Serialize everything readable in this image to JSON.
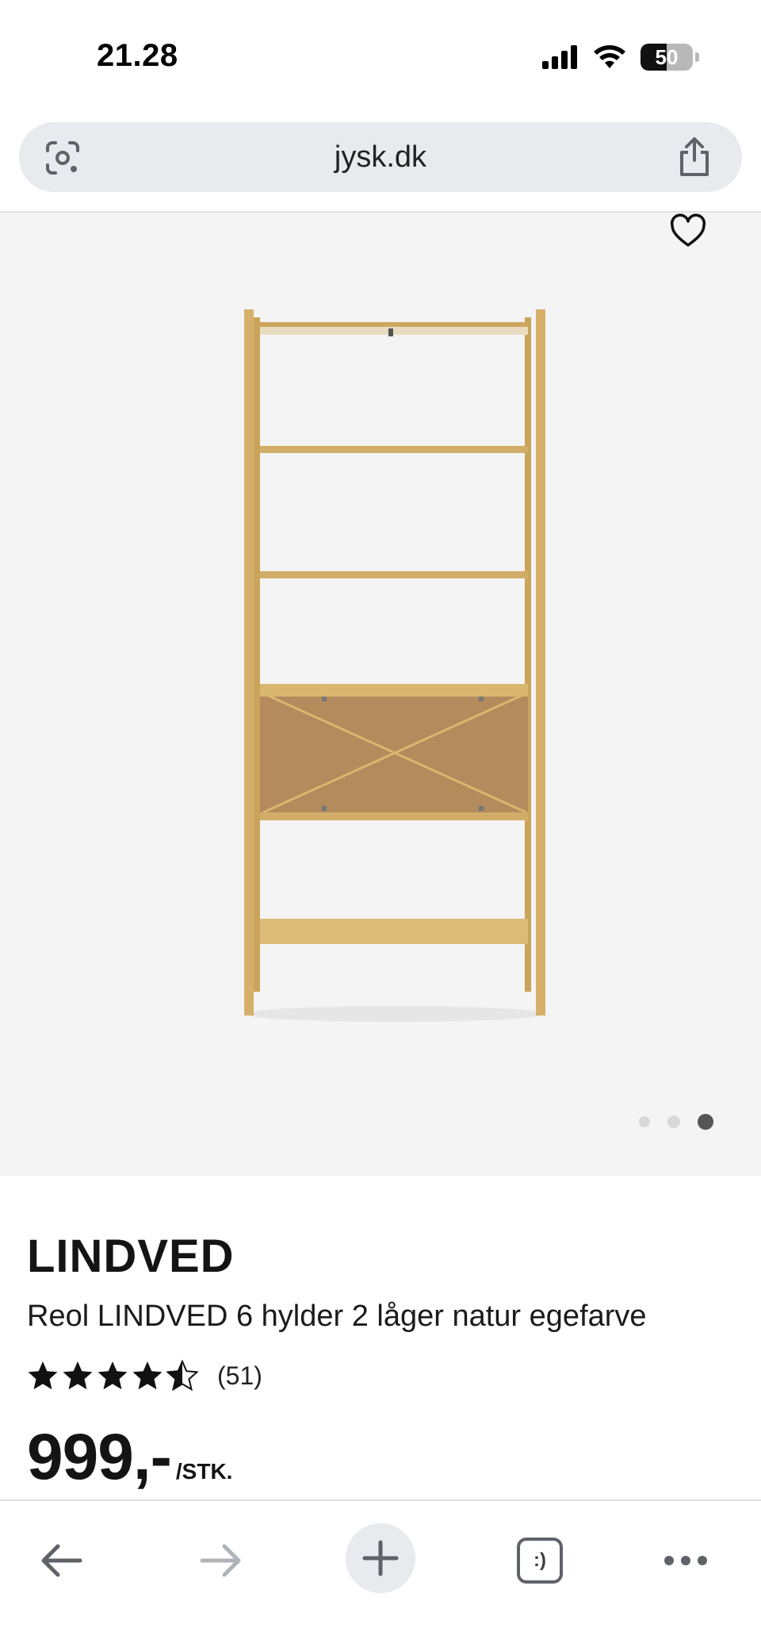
{
  "status_bar": {
    "time": "21.28",
    "battery": "50",
    "battery_level": 0.5
  },
  "browser": {
    "url": "jysk.dk",
    "icons": {
      "lens": "google-lens-icon",
      "share": "share-icon"
    }
  },
  "product": {
    "brand": "LINDVED",
    "title": "Reol LINDVED 6 hylder 2 låger natur egefarve",
    "rating": 4.5,
    "review_count": "(51)",
    "price": "999,-",
    "unit": "/STK.",
    "image_count": 3,
    "active_image": 3
  },
  "toolbar": {
    "tabs_label": ":)",
    "icons": [
      "back-icon",
      "forward-icon",
      "plus-icon",
      "tabs-icon",
      "more-icon"
    ]
  },
  "colors": {
    "image_bg": "#f4f4f4",
    "wood": "#d9b76e",
    "address_bar": "#e8eaee"
  }
}
